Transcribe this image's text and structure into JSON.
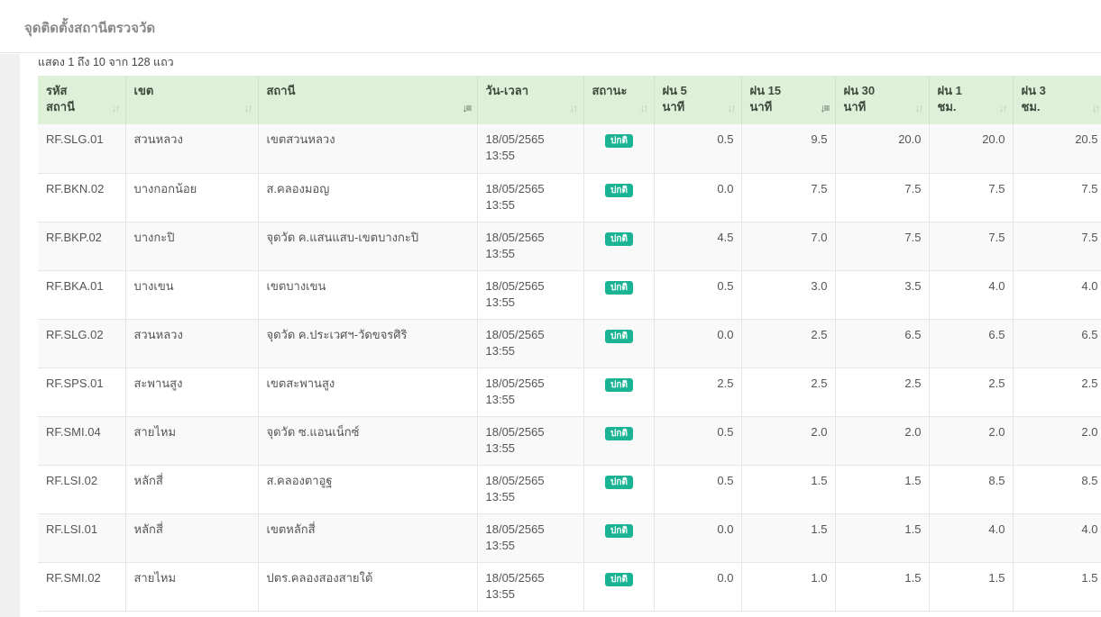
{
  "panel": {
    "title": "จุดติดตั้งสถานีตรวจวัด"
  },
  "info": "แสดง 1 ถึง 10 จาก 128 แถว",
  "columns": [
    {
      "line1": "รหัส",
      "line2": "สถานี",
      "sort": "both"
    },
    {
      "line1": "เขต",
      "line2": "",
      "sort": "both"
    },
    {
      "line1": "สถานี",
      "line2": "",
      "sort": "asc"
    },
    {
      "line1": "วัน-เวลา",
      "line2": "",
      "sort": "both"
    },
    {
      "line1": "สถานะ",
      "line2": "",
      "sort": "both"
    },
    {
      "line1": "ฝน 5",
      "line2": "นาที",
      "sort": "both"
    },
    {
      "line1": "ฝน 15",
      "line2": "นาที",
      "sort": "desc"
    },
    {
      "line1": "ฝน 30",
      "line2": "นาที",
      "sort": "both"
    },
    {
      "line1": "ฝน 1",
      "line2": "ชม.",
      "sort": "both"
    },
    {
      "line1": "ฝน 3",
      "line2": "ชม.",
      "sort": "both"
    }
  ],
  "rows": [
    {
      "code": "RF.SLG.01",
      "district": "สวนหลวง",
      "station": "เขตสวนหลวง",
      "date": "18/05/2565",
      "time": "13:55",
      "status": "ปกติ",
      "r5": "0.5",
      "r15": "9.5",
      "r30": "20.0",
      "r1h": "20.0",
      "r3h": "20.5"
    },
    {
      "code": "RF.BKN.02",
      "district": "บางกอกน้อย",
      "station": "ส.คลองมอญ",
      "date": "18/05/2565",
      "time": "13:55",
      "status": "ปกติ",
      "r5": "0.0",
      "r15": "7.5",
      "r30": "7.5",
      "r1h": "7.5",
      "r3h": "7.5"
    },
    {
      "code": "RF.BKP.02",
      "district": "บางกะปิ",
      "station": "จุดวัด ค.แสนแสบ-เขตบางกะปิ",
      "date": "18/05/2565",
      "time": "13:55",
      "status": "ปกติ",
      "r5": "4.5",
      "r15": "7.0",
      "r30": "7.5",
      "r1h": "7.5",
      "r3h": "7.5"
    },
    {
      "code": "RF.BKA.01",
      "district": "บางเขน",
      "station": "เขตบางเขน",
      "date": "18/05/2565",
      "time": "13:55",
      "status": "ปกติ",
      "r5": "0.5",
      "r15": "3.0",
      "r30": "3.5",
      "r1h": "4.0",
      "r3h": "4.0"
    },
    {
      "code": "RF.SLG.02",
      "district": "สวนหลวง",
      "station": "จุดวัด ค.ประเวศฯ-วัดขจรศิริ",
      "date": "18/05/2565",
      "time": "13:55",
      "status": "ปกติ",
      "r5": "0.0",
      "r15": "2.5",
      "r30": "6.5",
      "r1h": "6.5",
      "r3h": "6.5"
    },
    {
      "code": "RF.SPS.01",
      "district": "สะพานสูง",
      "station": "เขตสะพานสูง",
      "date": "18/05/2565",
      "time": "13:55",
      "status": "ปกติ",
      "r5": "2.5",
      "r15": "2.5",
      "r30": "2.5",
      "r1h": "2.5",
      "r3h": "2.5"
    },
    {
      "code": "RF.SMI.04",
      "district": "สายไหม",
      "station": "จุดวัด ซ.แอนเน็กซ์",
      "date": "18/05/2565",
      "time": "13:55",
      "status": "ปกติ",
      "r5": "0.5",
      "r15": "2.0",
      "r30": "2.0",
      "r1h": "2.0",
      "r3h": "2.0"
    },
    {
      "code": "RF.LSI.02",
      "district": "หลักสี่",
      "station": "ส.คลองตาอูฐ",
      "date": "18/05/2565",
      "time": "13:55",
      "status": "ปกติ",
      "r5": "0.5",
      "r15": "1.5",
      "r30": "1.5",
      "r1h": "8.5",
      "r3h": "8.5"
    },
    {
      "code": "RF.LSI.01",
      "district": "หลักสี่",
      "station": "เขตหลักสี่",
      "date": "18/05/2565",
      "time": "13:55",
      "status": "ปกติ",
      "r5": "0.0",
      "r15": "1.5",
      "r30": "1.5",
      "r1h": "4.0",
      "r3h": "4.0"
    },
    {
      "code": "RF.SMI.02",
      "district": "สายไหม",
      "station": "ปตร.คลองสองสายใต้",
      "date": "18/05/2565",
      "time": "13:55",
      "status": "ปกติ",
      "r5": "0.0",
      "r15": "1.0",
      "r30": "1.5",
      "r1h": "1.5",
      "r3h": "1.5"
    }
  ],
  "colors": {
    "header_bg": "#dff0d8",
    "badge_bg": "#1ab394"
  }
}
